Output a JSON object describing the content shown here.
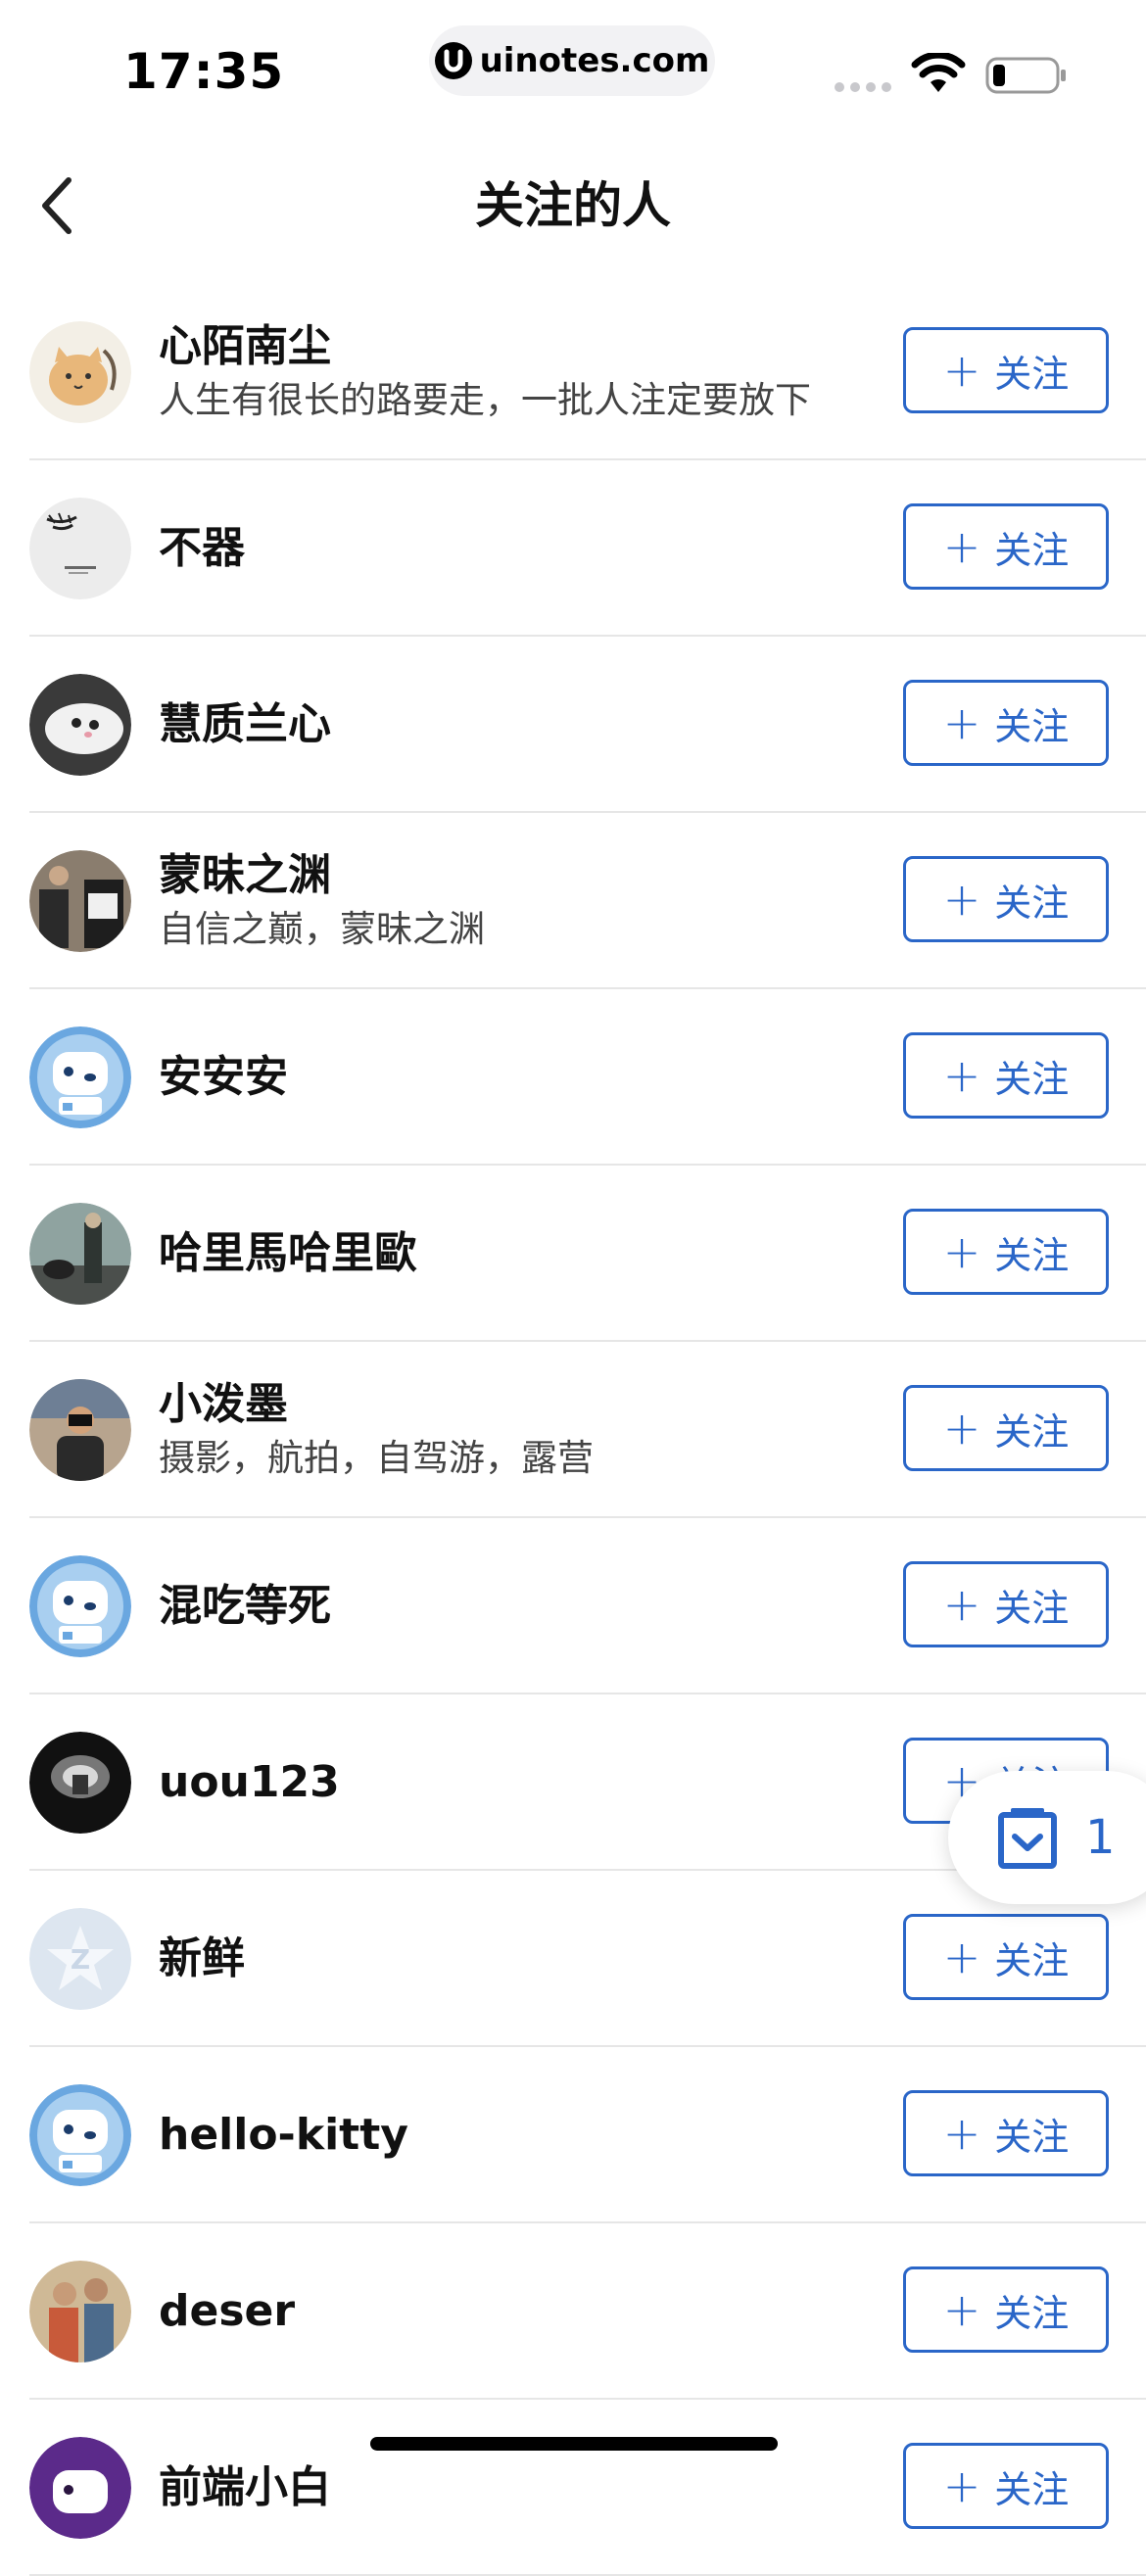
{
  "status_bar": {
    "time": "17:35",
    "url": "uinotes.com",
    "icons": [
      "cellular-dots-icon",
      "wifi-icon",
      "battery-icon"
    ]
  },
  "nav": {
    "back_icon": "chevron-left-icon",
    "title": "关注的人"
  },
  "follow_label": "关注",
  "users": [
    {
      "name": "心陌南尘",
      "bio": "人生有很长的路要走，一批人注定要放下",
      "avatar": "cartoon-cat"
    },
    {
      "name": "不器",
      "bio": "",
      "avatar": "ink-painting"
    },
    {
      "name": "慧质兰心",
      "bio": "",
      "avatar": "white-cat"
    },
    {
      "name": "蒙昧之渊",
      "bio": "自信之巅，蒙昧之渊",
      "avatar": "people-photo"
    },
    {
      "name": "安安安",
      "bio": "",
      "avatar": "default-blue"
    },
    {
      "name": "哈里馬哈里歐",
      "bio": "",
      "avatar": "scene-photo"
    },
    {
      "name": "小泼墨",
      "bio": "摄影，航拍，自驾游，露营",
      "avatar": "photographer"
    },
    {
      "name": "混吃等死",
      "bio": "",
      "avatar": "default-blue"
    },
    {
      "name": "uou123",
      "bio": "",
      "avatar": "dark-tunnel"
    },
    {
      "name": "新鲜",
      "bio": "",
      "avatar": "default-gray"
    },
    {
      "name": "hello-kitty",
      "bio": "",
      "avatar": "default-blue"
    },
    {
      "name": "deser",
      "bio": "",
      "avatar": "painting"
    },
    {
      "name": "前端小白",
      "bio": "",
      "avatar": "default-purple"
    }
  ],
  "floating_badge": {
    "icon": "clipboard-check-icon",
    "count": "1"
  },
  "colors": {
    "accent": "#2a66c8",
    "divider": "#e6e6e6",
    "default_avatar_blue": "#6aa7e0",
    "default_avatar_gray": "#dde6f0",
    "default_avatar_purple": "#5b2a8a"
  }
}
